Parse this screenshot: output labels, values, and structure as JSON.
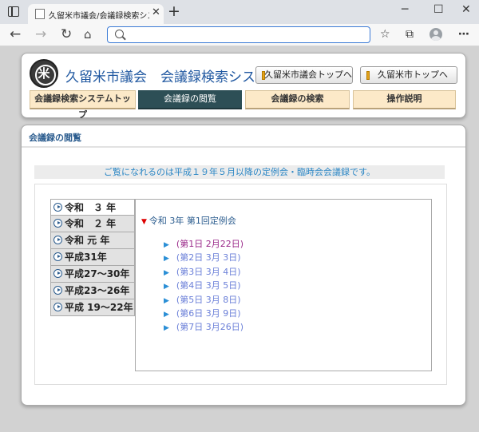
{
  "browser": {
    "tab_title": "久留米市議会/会議録検索システム",
    "url": ""
  },
  "header": {
    "title": "久留米市議会　会議録検索システム",
    "top_links": [
      {
        "label": "久留米市議会トップへ"
      },
      {
        "label": "久留米市トップへ"
      }
    ],
    "nav": [
      {
        "label": "会議録検索システムトップ"
      },
      {
        "label": "会議録の閲覧"
      },
      {
        "label": "会議録の検索"
      },
      {
        "label": "操作説明"
      }
    ]
  },
  "content": {
    "heading": "会議録の閲覧",
    "notice": "ご覧になれるのは平成１９年５月以降の定例会・臨時会会議録です。",
    "years": [
      {
        "label": "令和　３ 年"
      },
      {
        "label": "令和　２ 年"
      },
      {
        "label": "令和 元 年"
      },
      {
        "label": "平成31年"
      },
      {
        "label": "平成27〜30年"
      },
      {
        "label": "平成23〜26年"
      },
      {
        "label": "平成 19〜22年"
      }
    ],
    "session_title": "令和 3年 第1回定例会",
    "days": [
      {
        "label": "(第1日 2月22日)"
      },
      {
        "label": "(第2日 3月 3日)"
      },
      {
        "label": "(第3日 3月 4日)"
      },
      {
        "label": "(第4日 3月 5日)"
      },
      {
        "label": "(第5日 3月 8日)"
      },
      {
        "label": "(第6日 3月 9日)"
      },
      {
        "label": "(第7日 3月26日)"
      }
    ]
  },
  "colors": {
    "nav_active": "#2d4f56",
    "nav_inactive": "#fce9c8",
    "title": "#1f57a0",
    "link": "#6a7fd8",
    "visited": "#9b2a8a"
  }
}
